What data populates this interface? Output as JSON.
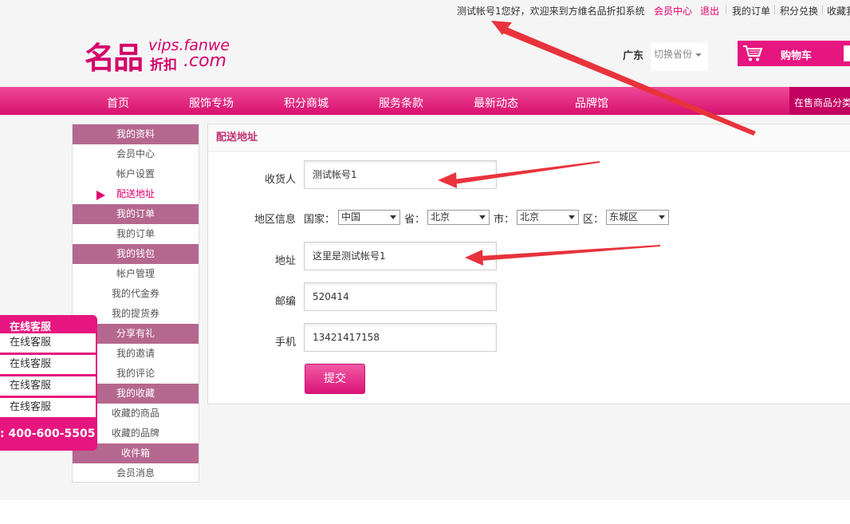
{
  "topbar": {
    "welcome": "测试帐号1您好，欢迎来到方维名品折扣系统",
    "member_center": "会员中心",
    "logout": "退出",
    "my_orders": "我的订单",
    "points_exchange": "积分兑换",
    "favorites": "收藏我"
  },
  "logo": {
    "big": "名品",
    "en": "vips.fanwe",
    "cn": "折扣",
    "com": ".com"
  },
  "header": {
    "region": "广东",
    "switch_province": "切换省份",
    "cart": "购物车"
  },
  "nav": {
    "items": [
      "首页",
      "服饰专场",
      "积分商城",
      "服务条款",
      "最新动态",
      "品牌馆"
    ],
    "category": "在售商品分类"
  },
  "sidebar": {
    "sec_profile": "我的资料",
    "member_center": "会员中心",
    "account_settings": "帐户设置",
    "delivery_address": "配送地址",
    "sec_orders": "我的订单",
    "my_orders": "我的订单",
    "sec_wallet": "我的钱包",
    "account_manage": "帐户管理",
    "my_vouchers": "我的代金券",
    "my_pickup": "我的提货券",
    "sec_share": "分享有礼",
    "my_invites": "我的邀请",
    "my_reviews": "我的评论",
    "sec_favorites": "我的收藏",
    "fav_goods": "收藏的商品",
    "fav_brands": "收藏的品牌",
    "sec_inbox": "收件箱",
    "member_messages": "会员消息"
  },
  "form": {
    "title": "配送地址",
    "consignee_label": "收货人",
    "consignee_value": "测试帐号1",
    "region_label": "地区信息",
    "country_label": "国家：",
    "country_value": "中国",
    "province_label": "省：",
    "province_value": "北京",
    "city_label": "市：",
    "city_value": "北京",
    "district_label": "区：",
    "district_value": "东城区",
    "address_label": "地址",
    "address_value": "这里是测试帐号1",
    "zip_label": "邮编",
    "zip_value": "520414",
    "mobile_label": "手机",
    "mobile_value": "13421417158",
    "submit": "提交"
  },
  "service": {
    "header": "在线客服",
    "items": [
      "在线客服",
      "在线客服",
      "在线客服",
      "在线客服"
    ],
    "phone": ": 400-600-5505"
  },
  "colors": {
    "brand": "#e6157f",
    "sidebar_section": "#b5688f",
    "annotation_arrow": "#e8333c"
  }
}
